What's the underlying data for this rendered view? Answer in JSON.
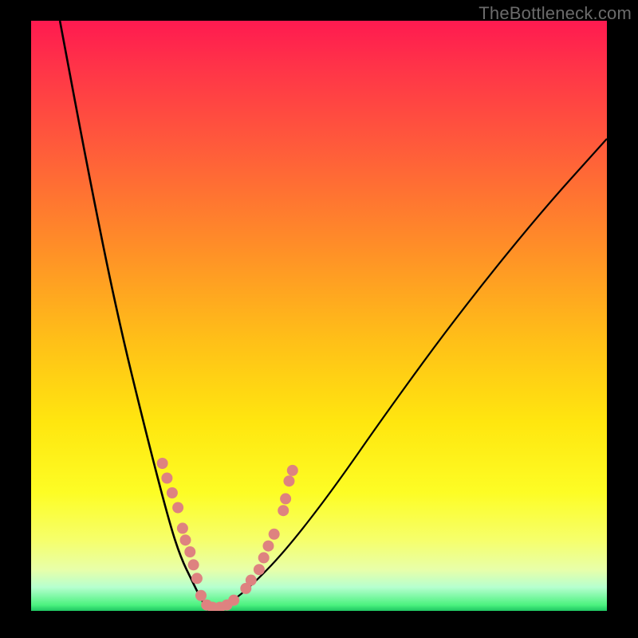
{
  "watermark": "TheBottleneck.com",
  "chart_data": {
    "type": "line",
    "title": "",
    "xlabel": "",
    "ylabel": "",
    "xlim": [
      0,
      100
    ],
    "ylim": [
      0,
      100
    ],
    "gradient_bands": [
      {
        "name": "red",
        "y_pct": 0
      },
      {
        "name": "orange",
        "y_pct": 38
      },
      {
        "name": "yellow",
        "y_pct": 70
      },
      {
        "name": "pale",
        "y_pct": 90
      },
      {
        "name": "green",
        "y_pct": 99
      }
    ],
    "series": [
      {
        "name": "left-curve",
        "x": [
          5,
          10,
          15,
          20,
          24,
          26,
          28,
          29.5,
          30.5,
          31
        ],
        "y": [
          100,
          74,
          50,
          30,
          15,
          9,
          5,
          2,
          0.5,
          0
        ]
      },
      {
        "name": "right-curve",
        "x": [
          31,
          34,
          38,
          44,
          52,
          62,
          74,
          88,
          100
        ],
        "y": [
          0,
          1,
          4,
          10,
          20,
          34,
          50,
          67,
          80
        ]
      }
    ],
    "markers": {
      "color": "#de8280",
      "radius": 7,
      "points": [
        {
          "x": 22.8,
          "y": 25.0
        },
        {
          "x": 23.6,
          "y": 22.5
        },
        {
          "x": 24.5,
          "y": 20.0
        },
        {
          "x": 25.5,
          "y": 17.5
        },
        {
          "x": 26.3,
          "y": 14.0
        },
        {
          "x": 26.8,
          "y": 12.0
        },
        {
          "x": 27.6,
          "y": 10.0
        },
        {
          "x": 28.2,
          "y": 7.8
        },
        {
          "x": 28.8,
          "y": 5.5
        },
        {
          "x": 29.5,
          "y": 2.6
        },
        {
          "x": 30.5,
          "y": 1.0
        },
        {
          "x": 31.5,
          "y": 0.6
        },
        {
          "x": 32.8,
          "y": 0.6
        },
        {
          "x": 34.0,
          "y": 1.0
        },
        {
          "x": 35.2,
          "y": 1.8
        },
        {
          "x": 37.3,
          "y": 3.8
        },
        {
          "x": 38.2,
          "y": 5.2
        },
        {
          "x": 39.6,
          "y": 7.0
        },
        {
          "x": 40.4,
          "y": 9.0
        },
        {
          "x": 41.2,
          "y": 11.0
        },
        {
          "x": 42.2,
          "y": 13.0
        },
        {
          "x": 43.8,
          "y": 17.0
        },
        {
          "x": 44.2,
          "y": 19.0
        },
        {
          "x": 44.8,
          "y": 22.0
        },
        {
          "x": 45.4,
          "y": 23.8
        }
      ]
    }
  }
}
